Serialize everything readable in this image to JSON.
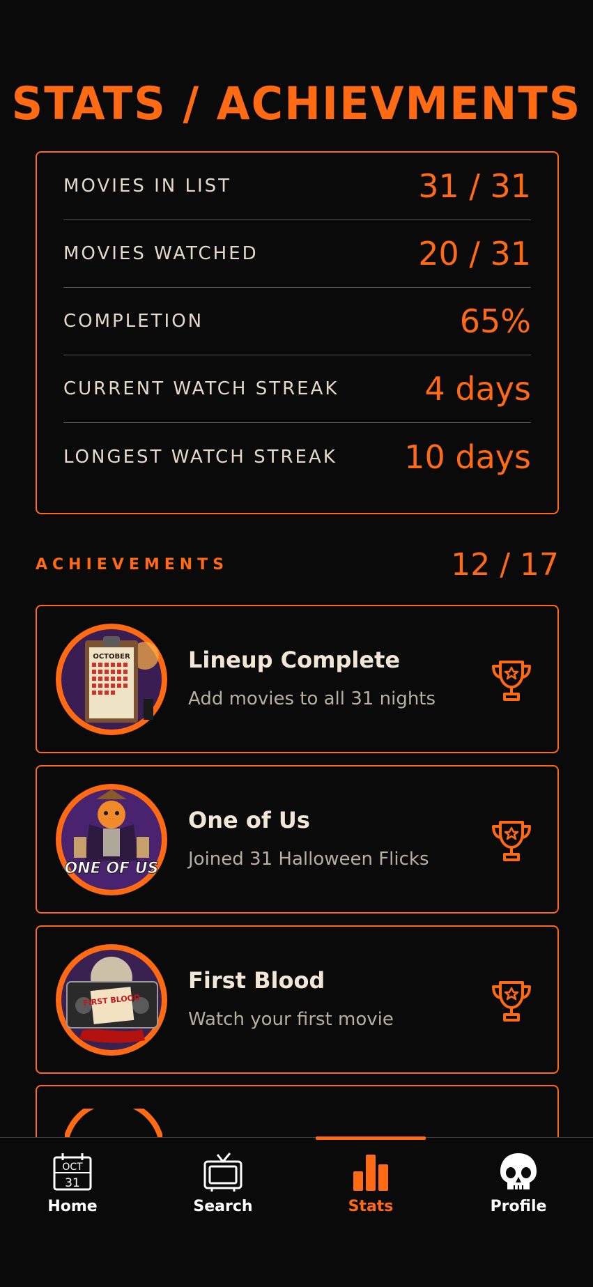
{
  "page": {
    "title": "STATS / ACHIEVMENTS"
  },
  "stats": [
    {
      "label": "MOVIES IN LIST",
      "value": "31 / 31"
    },
    {
      "label": "MOVIES WATCHED",
      "value": "20 / 31"
    },
    {
      "label": "COMPLETION",
      "value": "65%"
    },
    {
      "label": "CURRENT WATCH STREAK",
      "value": "4 days"
    },
    {
      "label": "LONGEST WATCH STREAK",
      "value": "10 days"
    }
  ],
  "achievements": {
    "title": "ACHIEVEMENTS",
    "count": "12 / 17",
    "items": [
      {
        "name": "Lineup Complete",
        "description": "Add movies to all 31 nights",
        "badge_text": "OCTOBER",
        "icon": "calendar-badge-icon"
      },
      {
        "name": "One of Us",
        "description": "Joined 31 Halloween Flicks",
        "badge_text": "ONE OF US",
        "icon": "scarecrow-badge-icon"
      },
      {
        "name": "First Blood",
        "description": "Watch your first movie",
        "badge_text": "FIRST BLOOD",
        "icon": "vhs-badge-icon"
      }
    ]
  },
  "tabs": [
    {
      "label": "Home",
      "icon": "calendar-icon",
      "calendar_month": "OCT",
      "calendar_day": "31"
    },
    {
      "label": "Search",
      "icon": "tv-icon"
    },
    {
      "label": "Stats",
      "icon": "bar-chart-icon",
      "active": true
    },
    {
      "label": "Profile",
      "icon": "skull-icon"
    }
  ],
  "colors": {
    "accent": "#ff6a13",
    "background": "#0a0a0a",
    "text": "#e8ddd0"
  }
}
